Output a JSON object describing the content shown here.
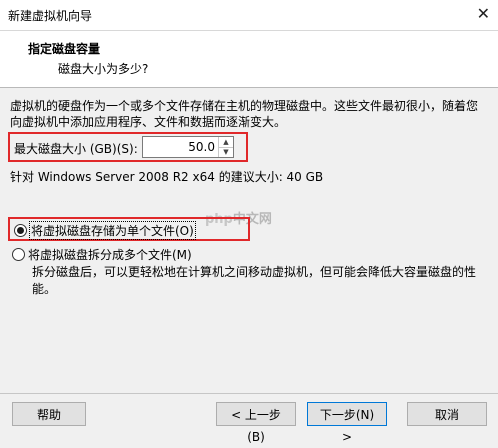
{
  "window": {
    "title": "新建虚拟机向导",
    "close_glyph": "✕"
  },
  "header": {
    "title": "指定磁盘容量",
    "subtitle": "磁盘大小为多少?"
  },
  "description": "虚拟机的硬盘作为一个或多个文件存储在主机的物理磁盘中。这些文件最初很小，随着您向虚拟机中添加应用程序、文件和数据而逐渐变大。",
  "max_disk": {
    "label": "最大磁盘大小 (GB)(S):",
    "value": "50.0"
  },
  "recommended": "针对 Windows Server 2008 R2 x64 的建议大小: 40 GB",
  "options": {
    "single": {
      "label": "将虚拟磁盘存储为单个文件(O)",
      "selected": true
    },
    "split": {
      "label": "将虚拟磁盘拆分成多个文件(M)",
      "selected": false,
      "description": "拆分磁盘后，可以更轻松地在计算机之间移动虚拟机，但可能会降低大容量磁盘的性能。"
    }
  },
  "watermark": {
    "brand": "php",
    "site": "中文网"
  },
  "buttons": {
    "help": "帮助",
    "back": "< 上一步(B)",
    "next": "下一步(N) >",
    "cancel": "取消"
  },
  "colors": {
    "highlight_box": "#e0282a",
    "accent": "#0078d7"
  }
}
